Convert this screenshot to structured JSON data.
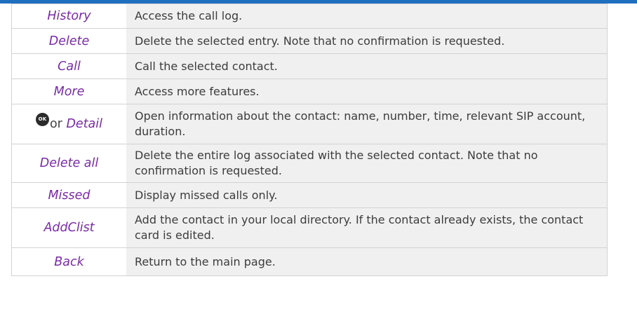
{
  "ok_button": {
    "label": "OK",
    "or_text": "or"
  },
  "rows": [
    {
      "key": "History",
      "description": "Access the call log."
    },
    {
      "key": "Delete",
      "description": "Delete the selected entry. Note that no confirmation is requested."
    },
    {
      "key": "Call",
      "description": "Call the selected contact."
    },
    {
      "key": "More",
      "description": "Access more features."
    },
    {
      "key": "Detail",
      "description": "Open information about the contact: name, number, time, relevant SIP account, duration."
    },
    {
      "key": "Delete all",
      "description": "Delete the entire log associated with the selected contact. Note that no confirmation is requested."
    },
    {
      "key": "Missed",
      "description": "Display missed calls only."
    },
    {
      "key": "AddClist",
      "description": "Add the contact in your local directory. If the contact already exists, the contact card is edited."
    },
    {
      "key": "Back",
      "description": "Return to the main page."
    }
  ],
  "colors": {
    "accent_bar": "#1e6fbf",
    "key_text": "#7a2aa6",
    "description_background": "#f0f0f0",
    "border": "#d2d2d2"
  }
}
